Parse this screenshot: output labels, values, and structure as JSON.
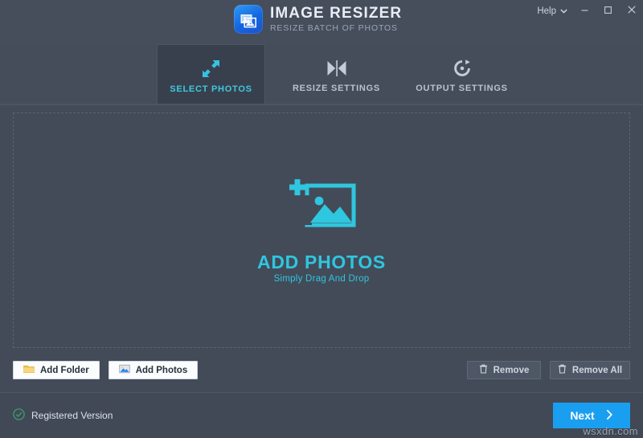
{
  "app": {
    "title": "IMAGE RESIZER",
    "subtitle": "RESIZE BATCH OF PHOTOS",
    "logo_icon": "photo-stack-icon",
    "accent_color": "#2fc6df",
    "primary_color": "#1a9ff0",
    "background_color": "#434b59"
  },
  "titlebar": {
    "help_label": "Help",
    "help_chevron_icon": "chevron-down-icon",
    "minimize_icon": "minimize-icon",
    "maximize_icon": "maximize-icon",
    "close_icon": "close-icon"
  },
  "tabs": [
    {
      "label": "SELECT PHOTOS",
      "icon": "expand-arrows-icon",
      "active": true
    },
    {
      "label": "RESIZE SETTINGS",
      "icon": "compress-horizontal-icon",
      "active": false
    },
    {
      "label": "OUTPUT SETTINGS",
      "icon": "rotate-refresh-icon",
      "active": false
    }
  ],
  "dropzone": {
    "icon": "add-photo-icon",
    "title": "ADD PHOTOS",
    "subtitle": "Simply Drag And Drop"
  },
  "actions": {
    "add_folder": {
      "label": "Add Folder",
      "icon": "folder-icon"
    },
    "add_photos": {
      "label": "Add Photos",
      "icon": "photo-icon"
    },
    "remove": {
      "label": "Remove",
      "icon": "trash-icon"
    },
    "remove_all": {
      "label": "Remove All",
      "icon": "trash-icon"
    }
  },
  "footer": {
    "registration_status": "Registered Version",
    "registration_icon": "check-circle-icon",
    "registration_color": "#3f9c6d",
    "next_label": "Next",
    "next_chevron_icon": "chevron-right-icon",
    "watermark": "wsxdn.com"
  }
}
